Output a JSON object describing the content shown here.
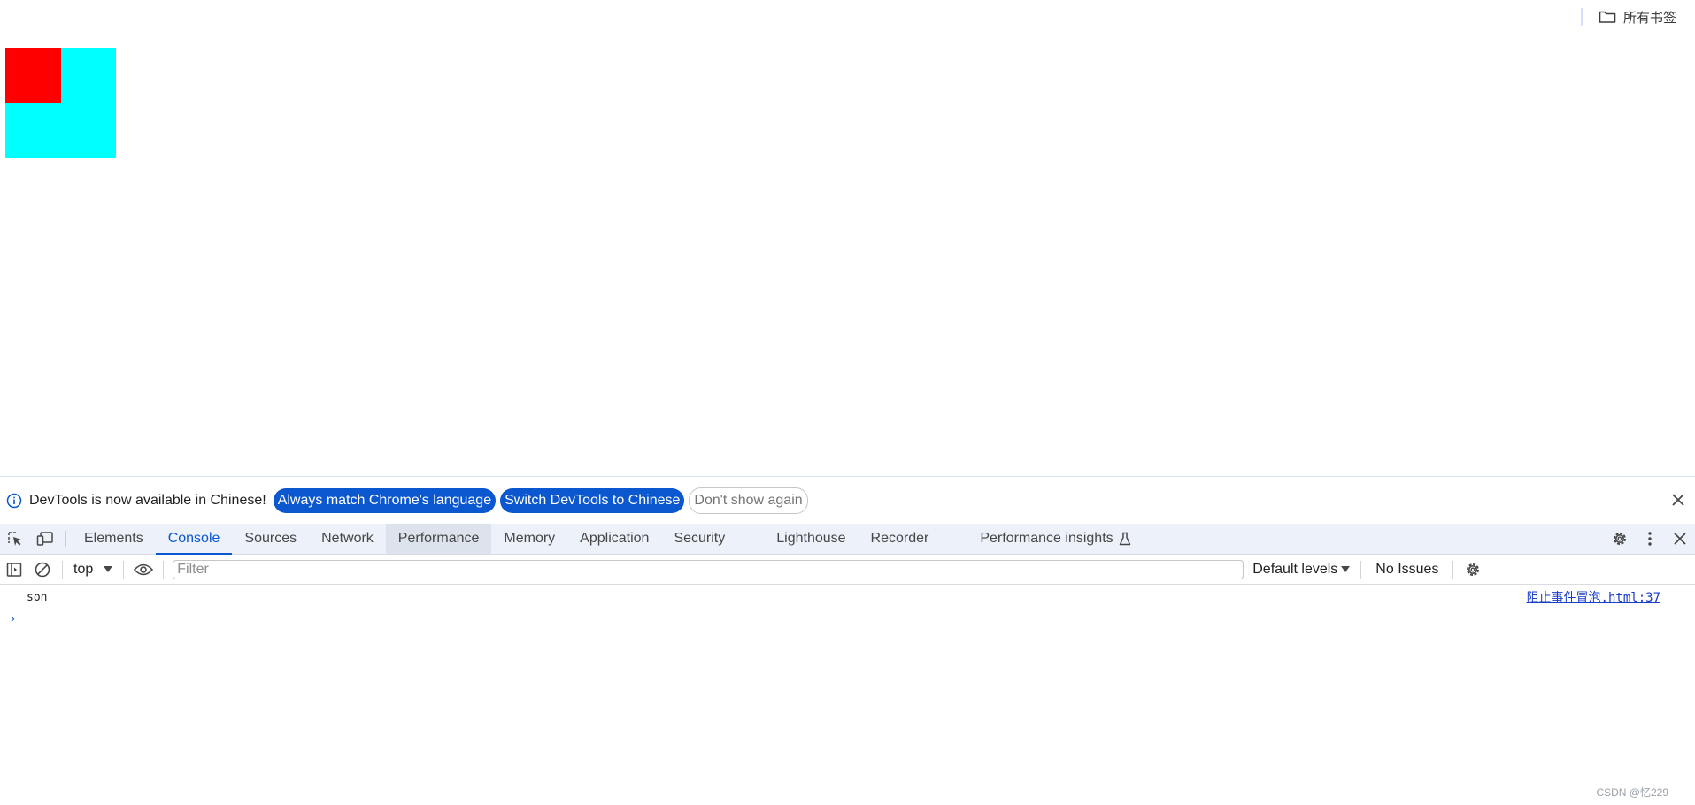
{
  "bookmarks": {
    "all_bookmarks_label": "所有书签"
  },
  "devtools": {
    "infobar": {
      "message": "DevTools is now available in Chinese!",
      "match_language_label": "Always match Chrome's language",
      "switch_label": "Switch DevTools to Chinese",
      "dont_show_label": "Don't show again"
    },
    "tabs": [
      {
        "label": "Elements"
      },
      {
        "label": "Console"
      },
      {
        "label": "Sources"
      },
      {
        "label": "Network"
      },
      {
        "label": "Performance"
      },
      {
        "label": "Memory"
      },
      {
        "label": "Application"
      },
      {
        "label": "Security"
      },
      {
        "label": "Lighthouse"
      },
      {
        "label": "Recorder"
      },
      {
        "label": "Performance insights"
      }
    ],
    "active_tab": "Console",
    "console_toolbar": {
      "context": "top",
      "filter_placeholder": "Filter",
      "levels_label": "Default levels",
      "issues_label": "No Issues"
    },
    "console_log": {
      "message": "son",
      "source": "阻止事件冒泡.html:37"
    }
  },
  "watermark": "CSDN @忆229",
  "colors": {
    "father_box": "#00ffff",
    "son_box": "#ff0000",
    "accent": "#0b57d0"
  }
}
